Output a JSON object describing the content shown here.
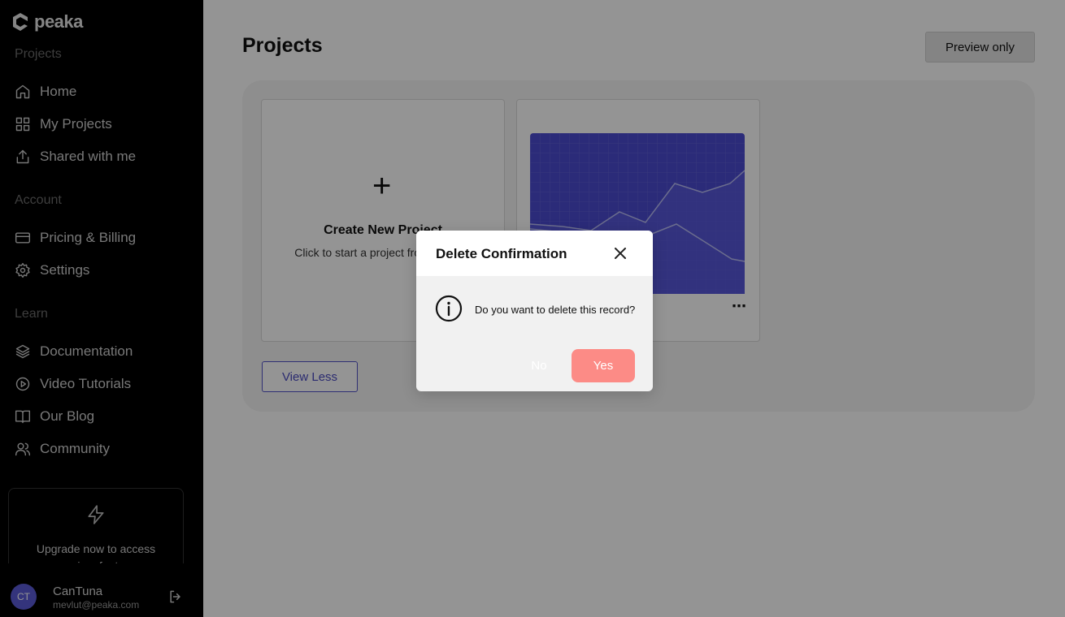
{
  "brand": {
    "name": "peaka"
  },
  "sidebar": {
    "sections": [
      {
        "label": "Projects",
        "items": [
          {
            "label": "Home",
            "icon": "home-icon"
          },
          {
            "label": "My Projects",
            "icon": "grid-icon"
          },
          {
            "label": "Shared with me",
            "icon": "share-icon"
          }
        ]
      },
      {
        "label": "Account",
        "items": [
          {
            "label": "Pricing & Billing",
            "icon": "credit-card-icon"
          },
          {
            "label": "Settings",
            "icon": "gear-icon"
          }
        ]
      },
      {
        "label": "Learn",
        "items": [
          {
            "label": "Documentation",
            "icon": "layers-icon"
          },
          {
            "label": "Video Tutorials",
            "icon": "play-circle-icon"
          },
          {
            "label": "Our Blog",
            "icon": "book-icon"
          },
          {
            "label": "Community",
            "icon": "users-icon"
          }
        ]
      }
    ],
    "upgrade": {
      "text": "Upgrade now to access premium features",
      "icon": "lightning-icon"
    },
    "user": {
      "initials": "CT",
      "name": "CanTuna",
      "email": "mevlut@peaka.com",
      "logout_icon": "logout-icon"
    }
  },
  "main": {
    "title": "Projects",
    "preview_label": "Preview only",
    "new_project": {
      "title": "Create New Project",
      "description": "Click to start a project from scratch."
    },
    "project_card": {
      "menu_icon": "more-horizontal-icon"
    },
    "view_less_label": "View Less"
  },
  "modal": {
    "title": "Delete Confirmation",
    "message": "Do you want to delete this record?",
    "no_label": "No",
    "yes_label": "Yes",
    "info_icon": "info-icon",
    "close_icon": "close-icon"
  },
  "colors": {
    "sidebar_bg": "#000000",
    "accent": "#5252c8",
    "confirm": "#fc8b86",
    "thumbnail": "#4b4bd1"
  }
}
